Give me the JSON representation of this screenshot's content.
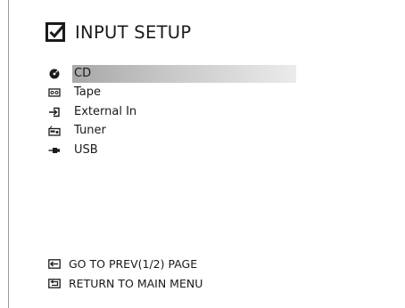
{
  "header": {
    "title": "INPUT SETUP",
    "icon": "checkbox-icon"
  },
  "inputs": [
    {
      "label": "CD",
      "icon": "cd-disc-icon",
      "selected": true
    },
    {
      "label": "Tape",
      "icon": "tape-cassette-icon",
      "selected": false
    },
    {
      "label": "External In",
      "icon": "external-in-icon",
      "selected": false
    },
    {
      "label": "Tuner",
      "icon": "tuner-icon",
      "selected": false
    },
    {
      "label": "USB",
      "icon": "usb-icon",
      "selected": false
    }
  ],
  "footer": {
    "prev_page": "GO TO PREV(1/2) PAGE",
    "prev_icon": "arrow-left-icon",
    "main_menu": "RETURN TO MAIN MENU",
    "main_icon": "return-arrow-icon"
  },
  "colors": {
    "text": "#1a1a1a",
    "highlight_start": "#a8a8a8",
    "highlight_end": "#ebebeb",
    "border": "#9a9a9a"
  }
}
